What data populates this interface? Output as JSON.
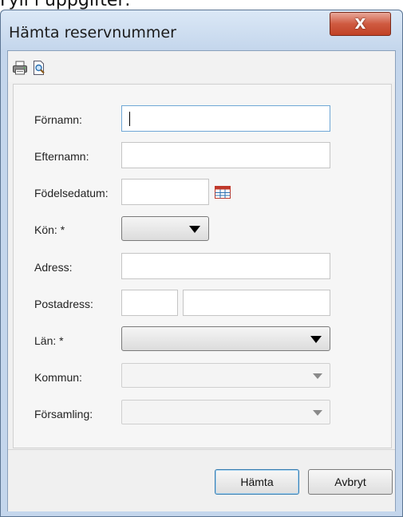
{
  "background_caption": "Fyll i uppgifter:",
  "window": {
    "title": "Hämta reservnummer",
    "close_symbol": "X"
  },
  "toolbar": {
    "icons": [
      "printer-icon",
      "print-preview-icon"
    ]
  },
  "form": {
    "fornamn_label": "Förnamn:",
    "fornamn_value": "",
    "efternamn_label": "Efternamn:",
    "efternamn_value": "",
    "fodelsedatum_label": "Födelsedatum:",
    "fodelsedatum_value": "",
    "kon_label": "Kön: *",
    "kon_value": "",
    "adress_label": "Adress:",
    "adress_value": "",
    "postadress_label": "Postadress:",
    "postnummer_value": "",
    "postort_value": "",
    "lan_label": "Län: *",
    "lan_value": "",
    "kommun_label": "Kommun:",
    "kommun_value": "",
    "forsamling_label": "Församling:",
    "forsamling_value": ""
  },
  "buttons": {
    "fetch_label": "Hämta",
    "cancel_label": "Avbryt"
  },
  "colors": {
    "calendar_icon": "#c0392b",
    "close_button": "#c9452a",
    "window_frame": "#c4d6ec"
  }
}
